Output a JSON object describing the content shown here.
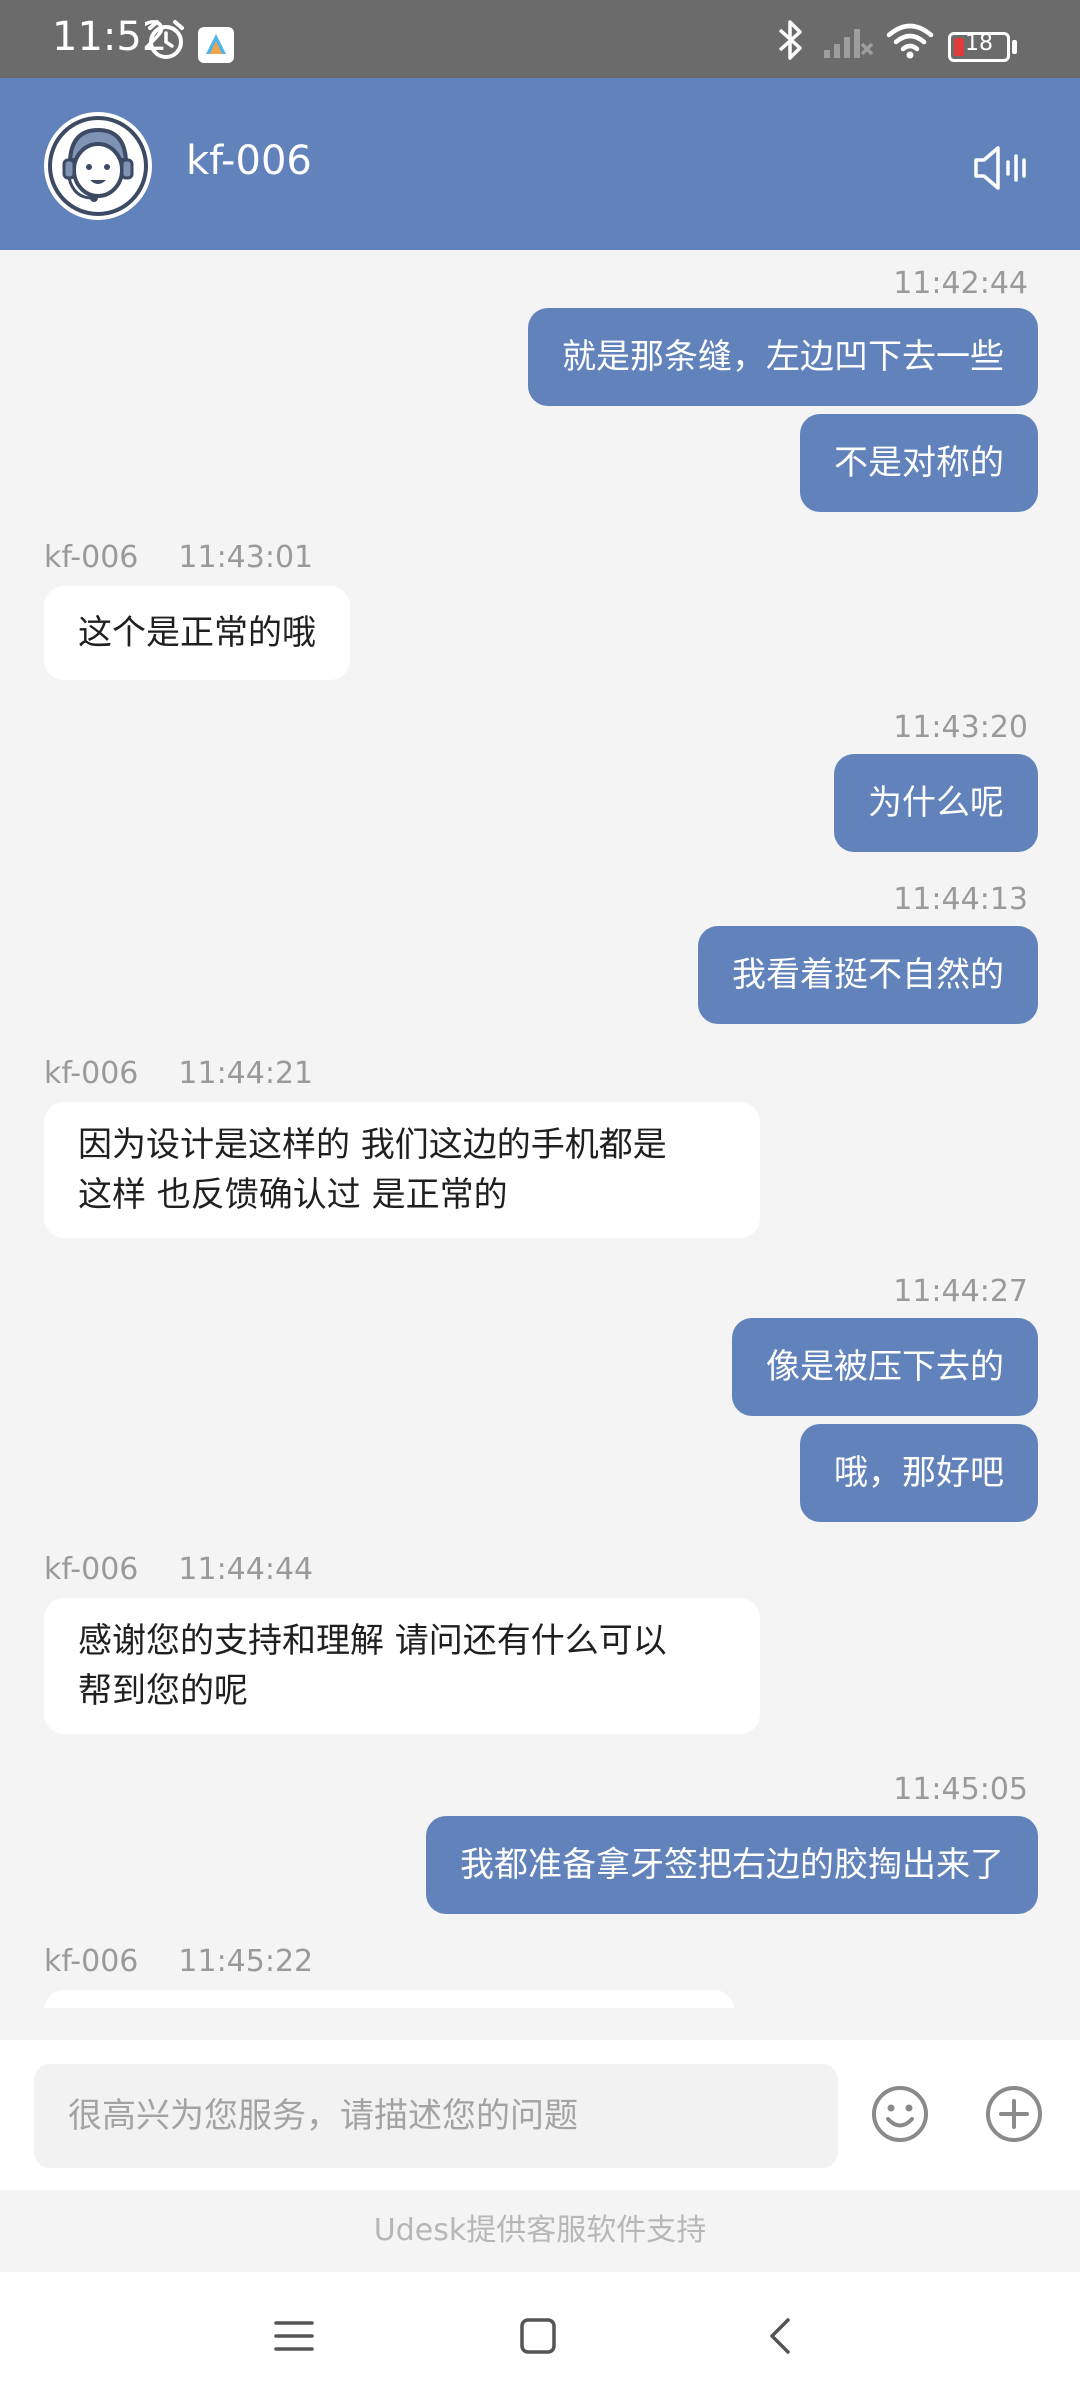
{
  "status_bar": {
    "time": "11:52",
    "battery": "18"
  },
  "header": {
    "agent_name": "kf-006"
  },
  "messages": {
    "m1": {
      "time": "11:42:44",
      "text": "就是那条缝，左边凹下去一些"
    },
    "m2": {
      "text": "不是对称的"
    },
    "m3": {
      "sender": "kf-006",
      "time": "11:43:01",
      "text": "这个是正常的哦"
    },
    "m4": {
      "time": "11:43:20",
      "text": "为什么呢"
    },
    "m5": {
      "time": "11:44:13",
      "text": "我看着挺不自然的"
    },
    "m6": {
      "sender": "kf-006",
      "time": "11:44:21",
      "line1": "因为设计是这样的 我们这边的手机都是",
      "line2": "这样 也反馈确认过 是正常的"
    },
    "m7": {
      "time": "11:44:27",
      "text": "像是被压下去的"
    },
    "m8": {
      "text": "哦，那好吧"
    },
    "m9": {
      "sender": "kf-006",
      "time": "11:44:44",
      "line1": "感谢您的支持和理解 请问还有什么可以",
      "line2": "帮到您的呢"
    },
    "m10": {
      "time": "11:45:05",
      "text": "我都准备拿牙签把右边的胶掏出来了"
    },
    "m11": {
      "sender": "kf-006",
      "time": "11:45:22"
    }
  },
  "input": {
    "placeholder": "很高兴为您服务，请描述您的问题",
    "value": ""
  },
  "footer": {
    "powered_by": "Udesk提供客服软件支持"
  },
  "icons": {
    "status": [
      "alarm-icon",
      "app-icon",
      "bluetooth-icon",
      "signal-icon",
      "wifi-icon",
      "battery-icon"
    ],
    "header": [
      "agent-avatar-icon",
      "speaker-icon"
    ],
    "input": [
      "emoji-icon",
      "plus-icon"
    ],
    "nav": [
      "menu-icon",
      "home-icon",
      "back-icon"
    ]
  },
  "colors": {
    "accent": "#6182bb",
    "status_bar": "#6b6b6b",
    "chat_background": "#f4f4f5",
    "incoming_bubble": "#ffffff",
    "timestamp": "#9a9a9a"
  }
}
